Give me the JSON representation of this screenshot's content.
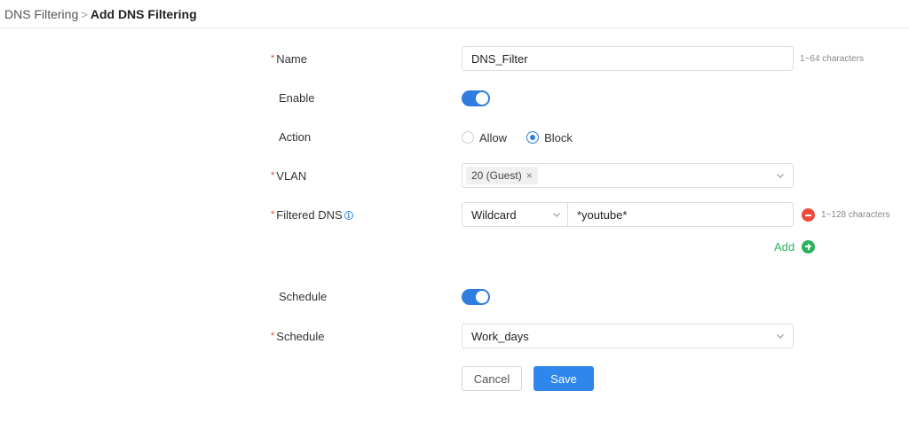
{
  "breadcrumb": {
    "parent": "DNS Filtering",
    "separator": ">",
    "current": "Add DNS Filtering"
  },
  "form": {
    "name": {
      "label": "Name",
      "required": true,
      "value": "DNS_Filter",
      "hint": "1~64 characters"
    },
    "enable": {
      "label": "Enable",
      "on": true
    },
    "action": {
      "label": "Action",
      "options": [
        {
          "label": "Allow",
          "checked": false
        },
        {
          "label": "Block",
          "checked": true
        }
      ]
    },
    "vlan": {
      "label": "VLAN",
      "required": true,
      "selected": [
        "20 (Guest)"
      ],
      "tag_remove_glyph": "×"
    },
    "filtered_dns": {
      "label": "Filtered DNS",
      "required": true,
      "info_glyph": "i",
      "match_type": "Wildcard",
      "value": "*youtube*",
      "hint": "1~128 characters",
      "add_label": "Add"
    },
    "schedule_toggle": {
      "label": "Schedule",
      "on": true
    },
    "schedule": {
      "label": "Schedule",
      "required": true,
      "value": "Work_days"
    }
  },
  "buttons": {
    "cancel": "Cancel",
    "save": "Save"
  },
  "colors": {
    "accent": "#2f7de1",
    "required": "#e5473c",
    "remove": "#ec4a3c",
    "add": "#27b35a",
    "save_button": "#2f86eb"
  }
}
